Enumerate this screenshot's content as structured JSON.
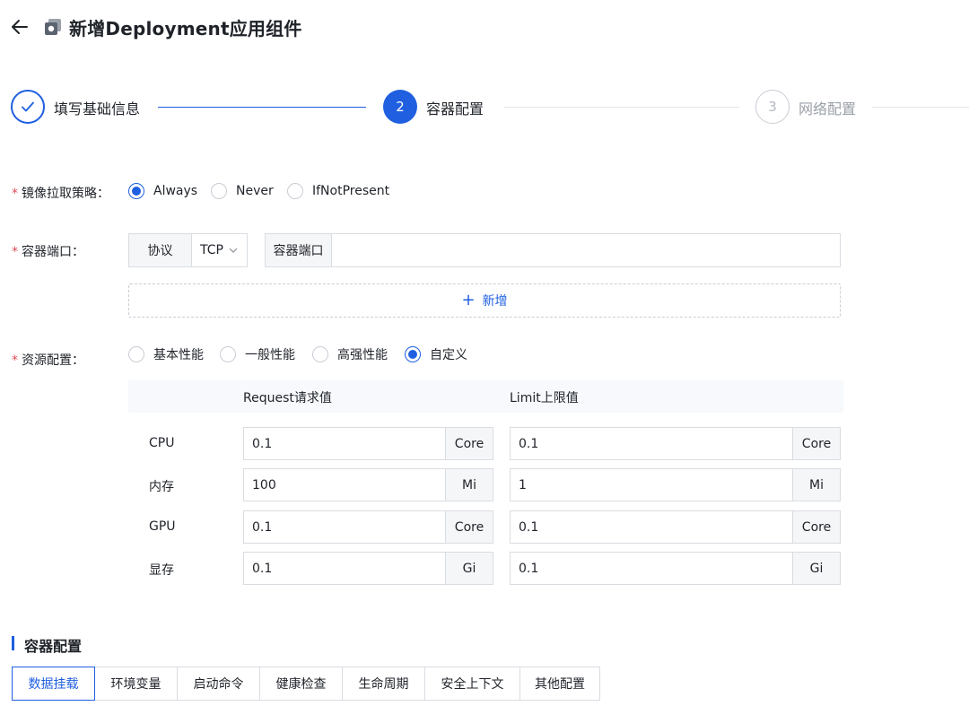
{
  "header": {
    "back_icon": "arrow-left-icon",
    "app_icon": "app-box-icon",
    "title": "新增Deployment应用组件"
  },
  "steps": [
    {
      "number": "",
      "label": "填写基础信息",
      "state": "done",
      "icon": "check-icon"
    },
    {
      "number": "2",
      "label": "容器配置",
      "state": "active"
    },
    {
      "number": "3",
      "label": "网络配置",
      "state": "pending"
    }
  ],
  "colors": {
    "primary": "#1f5fe0",
    "required": "#e34d59",
    "muted": "#b5b8bf",
    "border": "#d9dce1"
  },
  "pull_policy": {
    "label": "镜像拉取策略：",
    "options": [
      "Always",
      "Never",
      "IfNotPresent"
    ],
    "selected": "Always"
  },
  "container_port": {
    "label": "容器端口：",
    "protocol_addon": "协议",
    "protocol_value": "TCP",
    "port_addon": "容器端口",
    "port_value": "",
    "add_label": "新增"
  },
  "resources": {
    "label": "资源配置：",
    "options": [
      "基本性能",
      "一般性能",
      "高强性能",
      "自定义"
    ],
    "selected": "自定义",
    "col_request": "Request请求值",
    "col_limit": "Limit上限值",
    "rows": [
      {
        "name": "CPU",
        "request": "0.1",
        "request_unit": "Core",
        "limit": "0.1",
        "limit_unit": "Core"
      },
      {
        "name": "内存",
        "request": "100",
        "request_unit": "Mi",
        "limit": "1",
        "limit_unit": "Mi"
      },
      {
        "name": "GPU",
        "request": "0.1",
        "request_unit": "Core",
        "limit": "0.1",
        "limit_unit": "Core"
      },
      {
        "name": "显存",
        "request": "0.1",
        "request_unit": "Gi",
        "limit": "0.1",
        "limit_unit": "Gi"
      }
    ]
  },
  "section": {
    "title": "容器配置",
    "tabs": [
      "数据挂载",
      "环境变量",
      "启动命令",
      "健康检查",
      "生命周期",
      "安全上下文",
      "其他配置"
    ],
    "active_tab": "数据挂载"
  }
}
